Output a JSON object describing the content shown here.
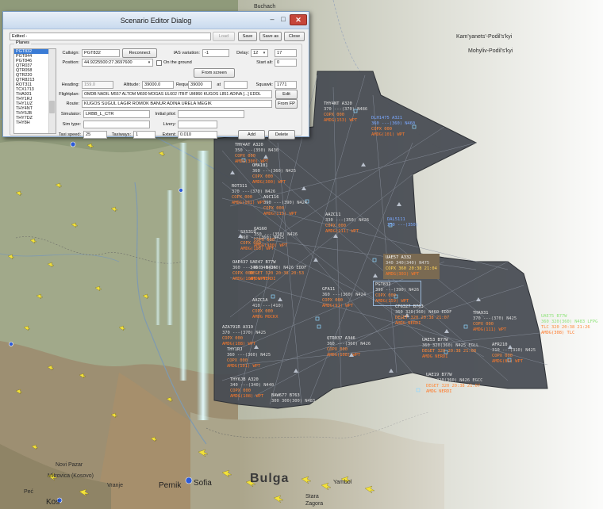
{
  "dialog": {
    "title": "Scenario Editor Dialog",
    "min_label": "–",
    "max_label": "□",
    "close_label": "✕",
    "status": "Edited -",
    "buttons": {
      "load": "Load",
      "save": "Save",
      "save_as": "Save as",
      "close": "Close"
    },
    "planes_legend": "Planes",
    "planes": [
      "PGT832",
      "PGT844",
      "PGT846",
      "QTR037",
      "QTR058",
      "QTR220",
      "QTR8213",
      "ROT311",
      "TCX1713",
      "THA931",
      "THY1RJ",
      "THY1UZ",
      "THY4NT",
      "THY6JB",
      "THY7DZ",
      "THY8H"
    ],
    "selected_plane": "PGT832",
    "fields": {
      "callsign_label": "Callsign:",
      "callsign": "PGT832",
      "reconnect": "Reconnect",
      "ias_label": "IAS variation:",
      "ias": "-1",
      "delay_label": "Delay:",
      "delay": "12",
      "delay_alt": "17",
      "position_label": "Position:",
      "position": "44.9225500:27.3697600",
      "on_ground": "On the ground",
      "start_label": "Start alt:",
      "start": "0",
      "from_screen": "From screen",
      "heading_label": "Heading:",
      "heading": "159.0",
      "altitude_label": "Altitude:",
      "altitude": "39000.0",
      "requested_label": "Requested alt:",
      "requested": "39000",
      "at_label": "at",
      "squawk_label": "Squawk:",
      "squawk": "1771",
      "flightplan_label": "Flightplan:",
      "flightplan": "OMDB NADIL M557 ALTOM M600 MOGAS UL602 ITBIT UM860 KUGOS L851 ADINA [...] EDDL",
      "edit": "Edit",
      "route_label": "Route:",
      "route": "KUGOS SUGUL LAGIR ROMOK BANUR ADINA URELА MEGIK",
      "from_fp": "From FP",
      "simulator_label": "Simulator:",
      "simulator": "LRBB_L_CTR",
      "initial_pilot_label": "Initial pilot:",
      "simtype_label": "Sim type:",
      "livery_label": "Livery:",
      "taxi_speed_label": "Taxi speed:",
      "taxi_speed": "25",
      "taxiways_label": "Taxiways:",
      "taxiways": "1",
      "extent_label": "Extent:",
      "extent": "0.010",
      "add": "Add",
      "delete": "Delete"
    }
  },
  "map_labels": {
    "buchach": "Buchach",
    "podilsky": "Kam'yanets'-Podil's'kyi",
    "mohyliv": "Mohyliv-Podil's'kyi",
    "novi_pazar": "Novi Pazar",
    "kosovo": "Mitrovica\n(Kosovo)",
    "vranje": "Vranje",
    "pec": "Peć",
    "pernik": "Pernik",
    "sofia": "Sofia",
    "kos": "Kos",
    "bulgaria": "Bulga",
    "yambol": "Yambol",
    "stara": "Stara",
    "zagora": "Zagora"
  },
  "radar_tags": [
    {
      "id": "thy4nt",
      "l1": "THY4NT A320",
      "l2": "370 ---(370) N486",
      "l3": "COPX 000",
      "l4": "AMDG(153) WPT"
    },
    {
      "id": "dlh1475",
      "l1": "DLH1475 A321",
      "l2": "360 ---(360) N460",
      "l3": "COPX 000",
      "l4": "AMDG(101) WPT"
    },
    {
      "id": "t1",
      "l1": "THY4AT A320",
      "l2": "350 ---(350) N430",
      "l3": "COPX 000",
      "l4": "AMDG(300) WPT"
    },
    {
      "id": "t2",
      "l1": "OMA101",
      "l2": "360 ---(360) N425",
      "l3": "COPX 000",
      "l4": "AMDG(300) WPT"
    },
    {
      "id": "t3",
      "l1": "ASC116",
      "l2": "390 ---(390) N424",
      "l3": "COPX 000",
      "l4": "AMDG(115) WPT"
    },
    {
      "id": "t4",
      "l1": "AAZC11",
      "l2": "330 ---(350) N426",
      "l3": "COPX 000",
      "l4": "AMDG(111) WPT"
    },
    {
      "id": "t5",
      "l1": "QAS60",
      "l2": "350 ---(350) N426",
      "l3": "COPX 000",
      "l4": "AMDG(300) WPT"
    },
    {
      "id": "t6",
      "l1": "UAE47 B77W",
      "l2": "340 340(340) N426 EDDF",
      "l3": "DEGET 320 20:38 20:53",
      "l4": "AMDG NERDI"
    },
    {
      "id": "sel",
      "l1": "UAE57 A332",
      "l2": "340 340(340) N475",
      "l3": "COPX 360 20:38 21:04",
      "l4": "AMDG(303) WPT"
    },
    {
      "id": "t7",
      "l1": "PGT832",
      "l2": "390 ---(390) N426",
      "l3": "COPX 000",
      "l4": "AMDG(159) WPT"
    },
    {
      "id": "t8",
      "l1": "GFA11",
      "l2": "360 ---(360) N424",
      "l3": "COPX 000",
      "l4": "AMDG(91) WPT"
    },
    {
      "id": "t9",
      "l1": "AAZC1A",
      "l2": "410 ---(410)",
      "l3": "COPX 000",
      "l4": "AMDG MOCKX"
    },
    {
      "id": "t10",
      "l1": "CFG327 B763",
      "l2": "360 320(360) N460 EDDF",
      "l3": "DEGET 320 20:38 21:07",
      "l4": "AMDG NERDI"
    },
    {
      "id": "t11",
      "l1": "THA931",
      "l2": "370 ---(370) N425",
      "l3": "COPX 000",
      "l4": "AMDG(111) WPT"
    },
    {
      "id": "t12",
      "l1": "AZA791R A319",
      "l2": "370 ---(370) N425",
      "l3": "COPX 000",
      "l4": "AMDG(108) WPT"
    },
    {
      "id": "t13",
      "l1": "QTR037 A346",
      "l2": "360 ---(360) N426",
      "l3": "COPX 000",
      "l4": "AMDG(108) WPT"
    },
    {
      "id": "t14",
      "l1": "UAE53 B77W",
      "l2": "360 320(360) N425 EGLL",
      "l3": "DEGET 320 20:38 21:08",
      "l4": "AMDG NERDI"
    },
    {
      "id": "t15",
      "l1": "AFR210",
      "l2": "310 ---(310) N425",
      "l3": "COPX 000",
      "l4": "AMDG(85) WPT"
    },
    {
      "id": "uae75",
      "l1": "UAE75 B77W",
      "l2": "360 320(360) N483 LFPG",
      "l3": "TLC 320 20:38 21:26",
      "l4": "AMDG(308) TLC"
    },
    {
      "id": "t16",
      "l1": "UAE19 B77W",
      "l2": "360 320(360) N426 EGCC",
      "l3": "DEGET 320 20:38 21:07",
      "l4": "AMDG NERDI"
    },
    {
      "id": "t17",
      "l1": "BAW677 B763",
      "l2": "300 300(300) N483",
      "l3": "",
      "l4": ""
    },
    {
      "id": "t18",
      "l1": "THY1RJ",
      "l2": "360 ---(360) N425",
      "l3": "COPX 000",
      "l4": "AMDG(101) WPT"
    },
    {
      "id": "t19",
      "l1": "THY6JB A320",
      "l2": "340 ---(340) N440",
      "l3": "COPX 000",
      "l4": "AMDG(108) WPT"
    },
    {
      "id": "t20",
      "l1": "OAE437",
      "l2": "360 ---(360) N425",
      "l3": "COPX 000",
      "l4": "AMDG(108) WPT"
    },
    {
      "id": "t21",
      "l1": "ROT311",
      "l2": "370 ---(370) N426",
      "l3": "COPX 000",
      "l4": "AMDG(101) WPT"
    },
    {
      "id": "t22",
      "l1": "SXS319",
      "l2": "360 ---(360) N425",
      "l3": "COPX 000",
      "l4": "AMDG(108) WPT"
    },
    {
      "id": "t23",
      "l1": "DAL5111",
      "l2": "350 ---(350)",
      "l3": "",
      "l4": ""
    }
  ]
}
